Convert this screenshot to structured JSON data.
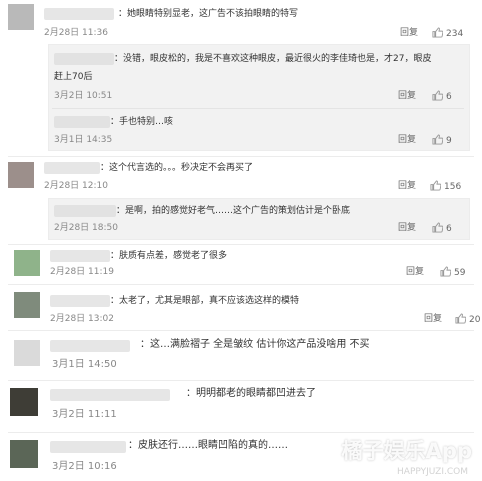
{
  "comments": [
    {
      "text": "：她眼睛特别显老，这广告不该拍眼睛的特写",
      "time": "2月28日 11:36",
      "reply_label": "回复",
      "likes": "234",
      "replies": [
        {
          "text1": "：没错，眼皮松的，我是不喜欢这种眼皮，最近很火的李佳琦也是，才27，眼皮",
          "text2": "赶上70后",
          "time": "3月2日 10:51",
          "reply_label": "回复",
          "likes": "6"
        },
        {
          "text1": "：手也特别…咳",
          "time": "3月1日 14:35",
          "reply_label": "回复",
          "likes": "9"
        }
      ]
    },
    {
      "text": "：这个代言选的。。。秒决定不会再买了",
      "time": "2月28日 12:10",
      "reply_label": "回复",
      "likes": "156",
      "replies": [
        {
          "text1": "：是啊，拍的感觉好老气……这个广告的策划估计是个卧底",
          "time": "2月28日 18:50",
          "reply_label": "回复",
          "likes": "6"
        }
      ]
    },
    {
      "text": "：肤质有点差，感觉老了很多",
      "time": "2月28日 11:19",
      "reply_label": "回复",
      "likes": "59"
    },
    {
      "text": "：太老了，尤其是眼部，真不应该选这样的模特",
      "time": "2月28日 13:02",
      "reply_label": "回复",
      "likes": "20"
    },
    {
      "text": "：这…满脸褶子 全是皱纹 估计你这产品没啥用 不买",
      "time": "3月1日 14:50"
    },
    {
      "text": "：明明都老的眼睛都凹进去了",
      "time": "3月2日 11:11"
    },
    {
      "text": "：皮肤还行……眼睛凹陷的真的……",
      "time": "3月2日 10:16"
    }
  ],
  "watermark": {
    "main": "橘子娱乐App",
    "sub": "HAPPYJUZI.COM"
  },
  "colors": {
    "like_icon": "#999999",
    "divider": "#ececec",
    "reply_bg": "#f2f2f2"
  },
  "icons": {
    "like": "thumbs-up-icon"
  }
}
